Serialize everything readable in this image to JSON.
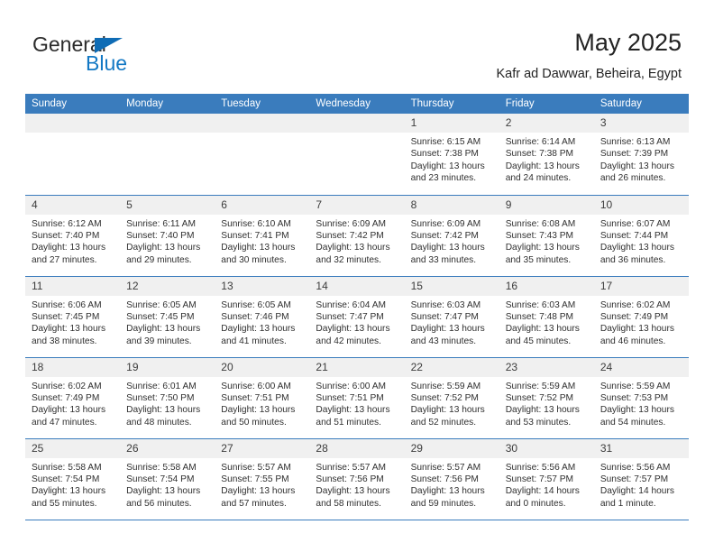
{
  "brand": {
    "name_top": "General",
    "name_bottom": "Blue",
    "triangle_color": "#0f6cb5",
    "blue_color": "#1378c4"
  },
  "header": {
    "title": "May 2025",
    "subtitle": "Kafr ad Dawwar, Beheira, Egypt",
    "accent_color": "#3a7cbd"
  },
  "calendar": {
    "weekday_headers": [
      "Sunday",
      "Monday",
      "Tuesday",
      "Wednesday",
      "Thursday",
      "Friday",
      "Saturday"
    ],
    "weeks": [
      [
        {
          "day": "",
          "lines": ""
        },
        {
          "day": "",
          "lines": ""
        },
        {
          "day": "",
          "lines": ""
        },
        {
          "day": "",
          "lines": ""
        },
        {
          "day": "1",
          "lines": "Sunrise: 6:15 AM\nSunset: 7:38 PM\nDaylight: 13 hours\nand 23 minutes."
        },
        {
          "day": "2",
          "lines": "Sunrise: 6:14 AM\nSunset: 7:38 PM\nDaylight: 13 hours\nand 24 minutes."
        },
        {
          "day": "3",
          "lines": "Sunrise: 6:13 AM\nSunset: 7:39 PM\nDaylight: 13 hours\nand 26 minutes."
        }
      ],
      [
        {
          "day": "4",
          "lines": "Sunrise: 6:12 AM\nSunset: 7:40 PM\nDaylight: 13 hours\nand 27 minutes."
        },
        {
          "day": "5",
          "lines": "Sunrise: 6:11 AM\nSunset: 7:40 PM\nDaylight: 13 hours\nand 29 minutes."
        },
        {
          "day": "6",
          "lines": "Sunrise: 6:10 AM\nSunset: 7:41 PM\nDaylight: 13 hours\nand 30 minutes."
        },
        {
          "day": "7",
          "lines": "Sunrise: 6:09 AM\nSunset: 7:42 PM\nDaylight: 13 hours\nand 32 minutes."
        },
        {
          "day": "8",
          "lines": "Sunrise: 6:09 AM\nSunset: 7:42 PM\nDaylight: 13 hours\nand 33 minutes."
        },
        {
          "day": "9",
          "lines": "Sunrise: 6:08 AM\nSunset: 7:43 PM\nDaylight: 13 hours\nand 35 minutes."
        },
        {
          "day": "10",
          "lines": "Sunrise: 6:07 AM\nSunset: 7:44 PM\nDaylight: 13 hours\nand 36 minutes."
        }
      ],
      [
        {
          "day": "11",
          "lines": "Sunrise: 6:06 AM\nSunset: 7:45 PM\nDaylight: 13 hours\nand 38 minutes."
        },
        {
          "day": "12",
          "lines": "Sunrise: 6:05 AM\nSunset: 7:45 PM\nDaylight: 13 hours\nand 39 minutes."
        },
        {
          "day": "13",
          "lines": "Sunrise: 6:05 AM\nSunset: 7:46 PM\nDaylight: 13 hours\nand 41 minutes."
        },
        {
          "day": "14",
          "lines": "Sunrise: 6:04 AM\nSunset: 7:47 PM\nDaylight: 13 hours\nand 42 minutes."
        },
        {
          "day": "15",
          "lines": "Sunrise: 6:03 AM\nSunset: 7:47 PM\nDaylight: 13 hours\nand 43 minutes."
        },
        {
          "day": "16",
          "lines": "Sunrise: 6:03 AM\nSunset: 7:48 PM\nDaylight: 13 hours\nand 45 minutes."
        },
        {
          "day": "17",
          "lines": "Sunrise: 6:02 AM\nSunset: 7:49 PM\nDaylight: 13 hours\nand 46 minutes."
        }
      ],
      [
        {
          "day": "18",
          "lines": "Sunrise: 6:02 AM\nSunset: 7:49 PM\nDaylight: 13 hours\nand 47 minutes."
        },
        {
          "day": "19",
          "lines": "Sunrise: 6:01 AM\nSunset: 7:50 PM\nDaylight: 13 hours\nand 48 minutes."
        },
        {
          "day": "20",
          "lines": "Sunrise: 6:00 AM\nSunset: 7:51 PM\nDaylight: 13 hours\nand 50 minutes."
        },
        {
          "day": "21",
          "lines": "Sunrise: 6:00 AM\nSunset: 7:51 PM\nDaylight: 13 hours\nand 51 minutes."
        },
        {
          "day": "22",
          "lines": "Sunrise: 5:59 AM\nSunset: 7:52 PM\nDaylight: 13 hours\nand 52 minutes."
        },
        {
          "day": "23",
          "lines": "Sunrise: 5:59 AM\nSunset: 7:52 PM\nDaylight: 13 hours\nand 53 minutes."
        },
        {
          "day": "24",
          "lines": "Sunrise: 5:59 AM\nSunset: 7:53 PM\nDaylight: 13 hours\nand 54 minutes."
        }
      ],
      [
        {
          "day": "25",
          "lines": "Sunrise: 5:58 AM\nSunset: 7:54 PM\nDaylight: 13 hours\nand 55 minutes."
        },
        {
          "day": "26",
          "lines": "Sunrise: 5:58 AM\nSunset: 7:54 PM\nDaylight: 13 hours\nand 56 minutes."
        },
        {
          "day": "27",
          "lines": "Sunrise: 5:57 AM\nSunset: 7:55 PM\nDaylight: 13 hours\nand 57 minutes."
        },
        {
          "day": "28",
          "lines": "Sunrise: 5:57 AM\nSunset: 7:56 PM\nDaylight: 13 hours\nand 58 minutes."
        },
        {
          "day": "29",
          "lines": "Sunrise: 5:57 AM\nSunset: 7:56 PM\nDaylight: 13 hours\nand 59 minutes."
        },
        {
          "day": "30",
          "lines": "Sunrise: 5:56 AM\nSunset: 7:57 PM\nDaylight: 14 hours\nand 0 minutes."
        },
        {
          "day": "31",
          "lines": "Sunrise: 5:56 AM\nSunset: 7:57 PM\nDaylight: 14 hours\nand 1 minute."
        }
      ]
    ]
  }
}
